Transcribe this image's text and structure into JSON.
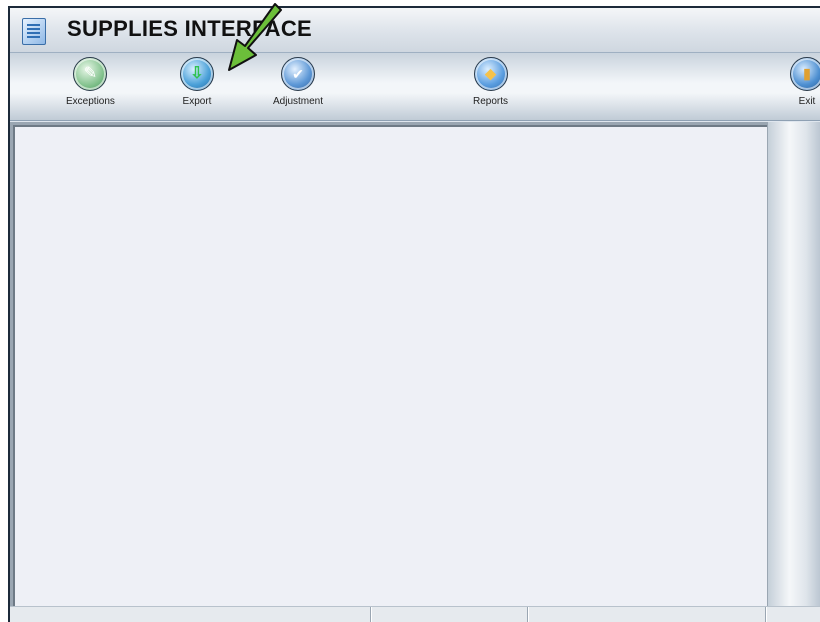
{
  "window": {
    "title": "SUPPLIES INTERFACE"
  },
  "toolbar": {
    "items": [
      {
        "label": "Exceptions",
        "icon": "exceptions-icon"
      },
      {
        "label": "Export",
        "icon": "export-icon"
      },
      {
        "label": "Adjustment",
        "icon": "adjustment-icon"
      },
      {
        "label": "Reports",
        "icon": "reports-icon"
      },
      {
        "label": "Exit",
        "icon": "exit-door-icon"
      }
    ]
  },
  "annotation": {
    "type": "arrow",
    "color": "#6cbf3a",
    "target": "Export"
  },
  "colors": {
    "panel_bg": "#eef0f6",
    "toolbar_bg": "#f3f6f9"
  }
}
